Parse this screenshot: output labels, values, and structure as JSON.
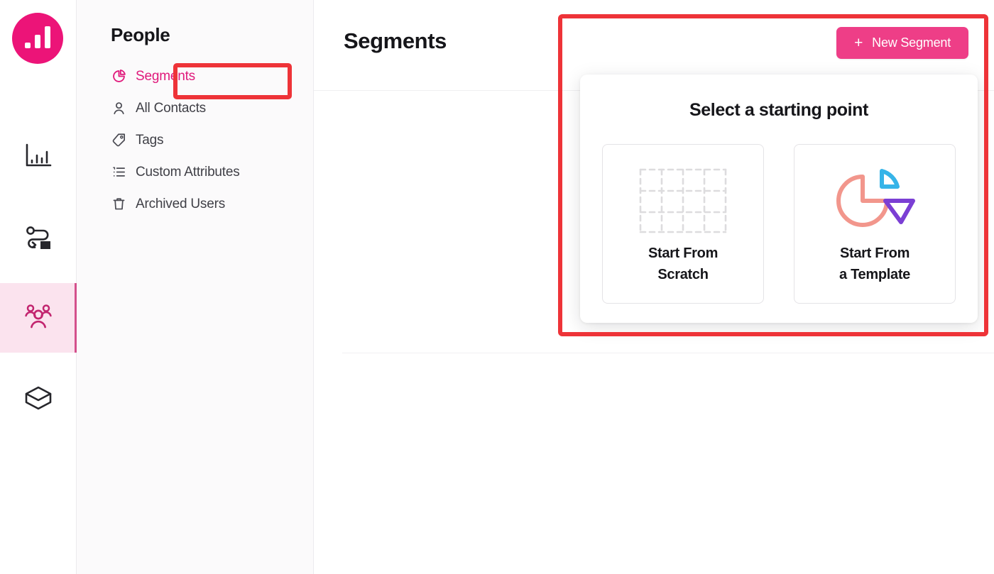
{
  "brand": {
    "logo_name": "analytics-logo",
    "accent_pink": "#EC1478",
    "button_pink": "#EE3E87",
    "annotation_red": "#EE3338",
    "active_nav_bg": "#FBE3EE"
  },
  "rail": {
    "items": [
      {
        "icon": "bar-chart-icon",
        "name": "analytics",
        "active": false
      },
      {
        "icon": "journey-flow-icon",
        "name": "journeys",
        "active": false
      },
      {
        "icon": "people-group-icon",
        "name": "people",
        "active": true
      },
      {
        "icon": "box-package-icon",
        "name": "catalog",
        "active": false
      }
    ]
  },
  "sidebar": {
    "title": "People",
    "items": [
      {
        "label": "Segments",
        "icon": "pie-chart-icon",
        "selected": true
      },
      {
        "label": "All Contacts",
        "icon": "user-icon",
        "selected": false
      },
      {
        "label": "Tags",
        "icon": "tag-icon",
        "selected": false
      },
      {
        "label": "Custom Attributes",
        "icon": "list-icon",
        "selected": false
      },
      {
        "label": "Archived Users",
        "icon": "trash-icon",
        "selected": false
      }
    ]
  },
  "main": {
    "page_title": "Segments",
    "new_segment_button": "New Segment",
    "plus_icon": "+"
  },
  "starting_point_panel": {
    "title": "Select a starting point",
    "options": [
      {
        "label_line1": "Start From",
        "label_line2": "Scratch",
        "icon": "dashed-grid-icon"
      },
      {
        "label_line1": "Start From",
        "label_line2": "a Template",
        "icon": "exploded-pie-chart-icon"
      }
    ]
  },
  "annotations": [
    {
      "name": "segments-nav-highlight",
      "target": "Segments"
    },
    {
      "name": "new-segment-panel-highlight",
      "target": "Select a starting point"
    }
  ]
}
